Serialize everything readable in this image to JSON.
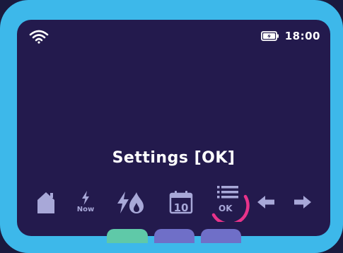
{
  "status_bar": {
    "wifi_icon": "wifi-icon",
    "battery_icon": "battery-charging-icon",
    "time": "18:00"
  },
  "message": "Settings [OK]",
  "toolbar": {
    "home_icon": "home-icon",
    "boost_now_label": "Now",
    "boost_flame_icon": "bolt-flame-icon",
    "calendar_day": "10",
    "menu_ok_label": "OK",
    "left_arrow_icon": "arrow-left-icon",
    "right_arrow_icon": "arrow-right-icon"
  },
  "colors": {
    "frame": "#3db8ea",
    "screen": "#231a4d",
    "icon": "#a8a8d8",
    "accent_pink": "#e8338a",
    "tab_green": "#5fc9a8",
    "tab_purple": "#6f6fc8"
  }
}
